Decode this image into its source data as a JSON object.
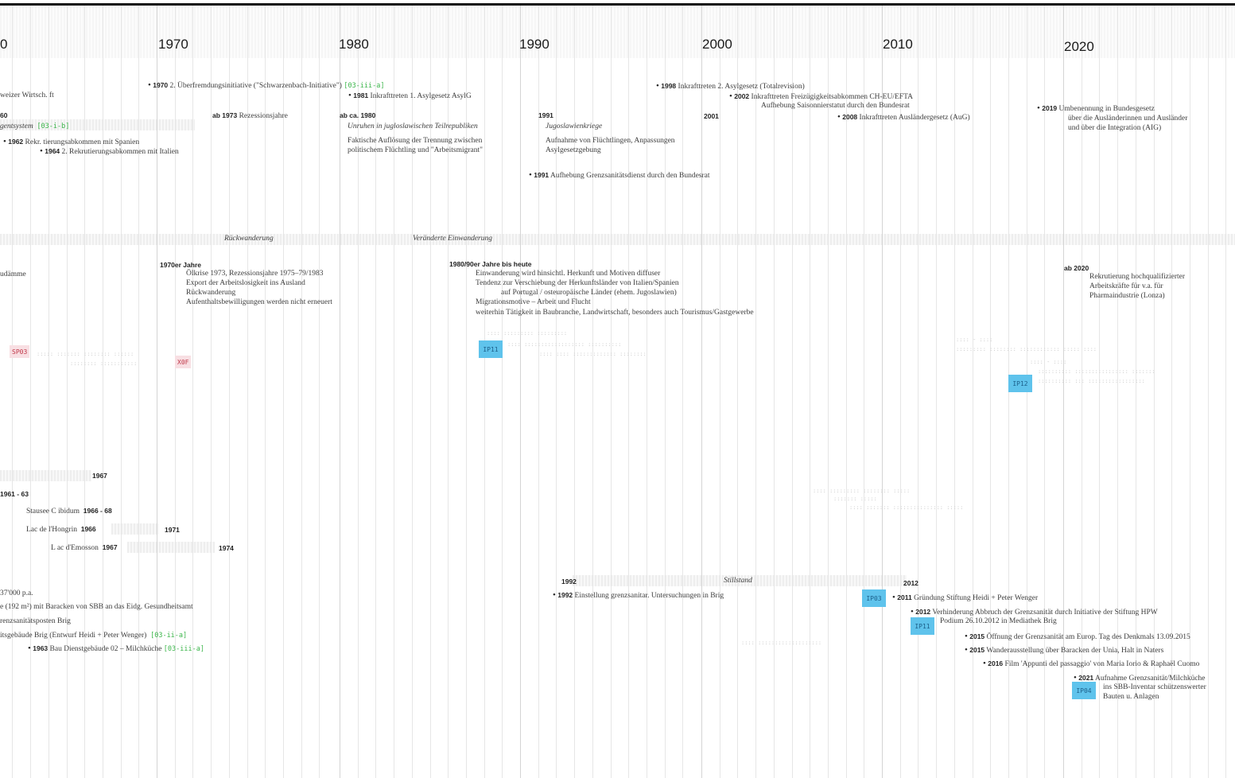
{
  "decades": [
    "0",
    "1970",
    "1980",
    "1990",
    "2000",
    "2010",
    "2020"
  ],
  "texts": [
    "weizer Wirtsch. ft",
    "60",
    "gentsystem",
    "[03-i-b]",
    "1962",
    "Rekr. tierungsabkommen mit Spanien",
    "1964",
    "2. Rekrutierungsabkommen mit Italien",
    "1970",
    "2. Überfremdungsinitiative (\"Schwarzenbach-Initiative\")",
    "[03-iii-a]",
    "1981",
    "Inkrafttreten 1. Asylgesetz AsylG",
    "ab 1973",
    "Rezessionsjahre",
    "ab ca. 1980",
    "Unruhen in jugloslawischen Teilrepubliken",
    "Faktische Auflösung der Trennung zwischen",
    "politischem Flüchtling und \"Arbeitsmigrant\"",
    "1991",
    "Jugoslawienkriege",
    "Aufnahme von Flüchtlingen, Anpassungen",
    "Asylgesetzgebung",
    "1991",
    "Aufhebung Grenzsanitätsdienst durch den Bundesrat",
    "1998",
    "Inkrafttreten 2. Asylgesetz (Totalrevision)",
    "2002",
    "Inkrafttreten Freizügigkeitsabkommen CH-EU/EFTA",
    "Aufhebung Saisonnierstatut durch den Bundesrat",
    "2001",
    "2008",
    "Inkrafttreten Ausländergesetz (AuG)",
    "2019",
    "Umbenennung in Bundesgesetz",
    "über die Ausländerinnen und Ausländer",
    "und über die Integration (AIG)",
    "Rückwanderung",
    "Veränderte Einwanderung",
    "udämme",
    "1970er Jahre",
    "Ölkrise 1973, Rezessionsjahre 1975–79/1983",
    "Export der Arbeitslosigkeit ins Ausland",
    "Rückwanderung",
    "Aufenthaltsbewilligungen werden nicht erneuert",
    "1980/90er Jahre bis heute",
    "Einwanderung wird hinsichtl. Herkunft und Motiven diffuser",
    "Tendenz zur Verschiebung der Herkunftsländer von Italien/Spanien",
    "auf Portugal / osteuropäische Länder (ehem. Jugoslawien)",
    "Migrationsmotive – Arbeit und Flucht",
    "weiterhin Tätigkeit in Baubranche, Landwirtschaft, besonders auch Tourismus/Gastgewerbe",
    "ab 2020",
    "Rekrutierung hochqualifizierter",
    "Arbeitskräfte für v.a. für",
    "Pharmaindustrie (Lonza)",
    "1967",
    "1961 - 63",
    "Stausee C ibidum",
    "1966 - 68",
    "Lac de l'Hongrin",
    "1966",
    "1971",
    "L ac d'Emosson",
    "1967",
    "1974",
    "37'000 p.a.",
    "e (192 m²) mit Baracken von SBB an das Eidg. Gesundheitsamt",
    "renzsanitätsposten Brig",
    "itsgebäude Brig (Entwurf Heidi + Peter Wenger)",
    "[03-ii-a]",
    "1963",
    "Bau Dienstgebäude 02 – Milchküche",
    "[03-iii-a]",
    "1992",
    "Stillstand",
    "1992",
    "Einstellung grenzsanitar. Untersuchungen in Brig",
    "2012",
    "2011",
    "Gründung Stiftung Heidi + Peter Wenger",
    "2012",
    "Verhinderung Abbruch der Grenzsanität durch Initiative der Stiftung HPW",
    "Podium 26.10.2012 in Mediathek Brig",
    "2015",
    "Öffnung der Grenzsanität am Europ. Tag des Denkmals 13.09.2015",
    "2015",
    "Wanderausstellung über Baracken der Unia, Halt in Naters",
    "2016",
    "Film 'Appunti del passaggio' von Maria Iorio & Raphaël Cuomo",
    "2021",
    "Aufnahme Grenzsanität/Milchküche",
    "ins SBB-Inventar schützenswerter",
    "Bauten u. Anlagen"
  ],
  "tags": [
    "IP11",
    "IP12",
    "IP03",
    "IP11",
    "IP04"
  ],
  "ptags": [
    "SP03",
    "X0F"
  ],
  "colors": {
    "tag_blue": "#5fc3ec",
    "ref_green": "#3bb54a",
    "tag_pink": "#f8dfe3"
  }
}
